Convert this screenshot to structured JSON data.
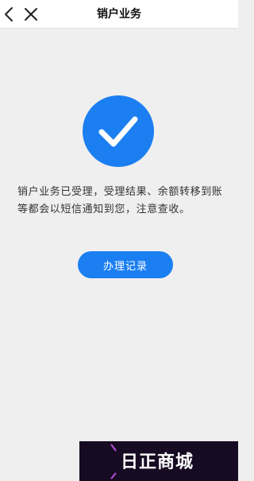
{
  "header": {
    "title": "销户业务"
  },
  "result": {
    "icon": "checkmark-circle-icon",
    "message": "销户业务已受理，受理结果、余额转移到账等都会以短信通知到您，注意查收。"
  },
  "actions": {
    "records_label": "办理记录"
  },
  "watermark": {
    "text": "日正商城"
  },
  "colors": {
    "accent": "#1b7ff2",
    "background": "#efefef",
    "nav_background": "#ffffff",
    "text": "#333333"
  }
}
